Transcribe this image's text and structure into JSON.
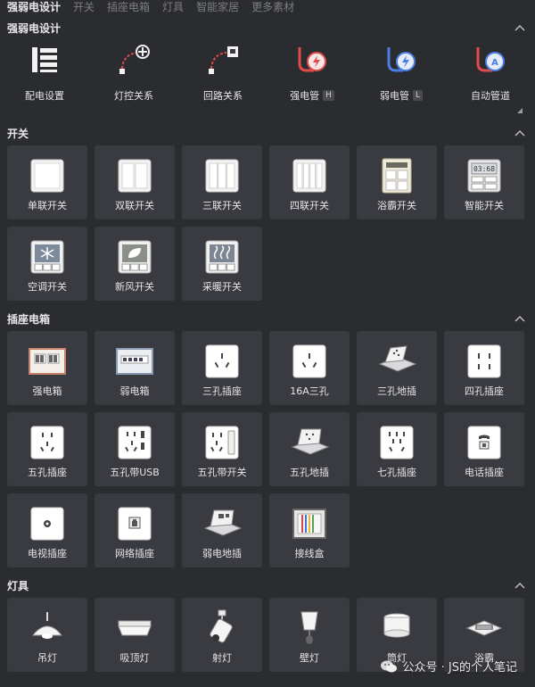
{
  "topnav": {
    "items": [
      {
        "label": "强弱电设计",
        "active": true
      },
      {
        "label": "开关",
        "active": false
      },
      {
        "label": "插座电箱",
        "active": false
      },
      {
        "label": "灯具",
        "active": false
      },
      {
        "label": "智能家居",
        "active": false
      },
      {
        "label": "更多素材",
        "active": false
      }
    ]
  },
  "sections": {
    "wiring": {
      "title": "强弱电设计",
      "collapse_icon": "chevron-up-icon",
      "tools": [
        {
          "label": "配电设置",
          "icon": "distribution-icon"
        },
        {
          "label": "灯控关系",
          "icon": "light-control-icon"
        },
        {
          "label": "回路关系",
          "icon": "circuit-icon"
        },
        {
          "label": "强电管",
          "tag": "H",
          "icon": "strong-pipe-icon",
          "color": "#e24b4b"
        },
        {
          "label": "弱电管",
          "tag": "L",
          "icon": "weak-pipe-icon",
          "color": "#4b7ee2"
        },
        {
          "label": "自动管道",
          "icon": "auto-pipe-icon",
          "color": "#4b7ee2"
        }
      ]
    },
    "switches": {
      "title": "开关",
      "items": [
        {
          "label": "单联开关",
          "icon": "single-switch-icon"
        },
        {
          "label": "双联开关",
          "icon": "double-switch-icon"
        },
        {
          "label": "三联开关",
          "icon": "triple-switch-icon"
        },
        {
          "label": "四联开关",
          "icon": "quad-switch-icon"
        },
        {
          "label": "浴霸开关",
          "icon": "bath-heater-switch-icon"
        },
        {
          "label": "智能开关",
          "icon": "smart-switch-icon",
          "display": "03:68"
        },
        {
          "label": "空调开关",
          "icon": "ac-switch-icon"
        },
        {
          "label": "新风开关",
          "icon": "fresh-air-switch-icon"
        },
        {
          "label": "采暖开关",
          "icon": "heating-switch-icon"
        }
      ]
    },
    "sockets": {
      "title": "插座电箱",
      "items": [
        {
          "label": "强电箱",
          "icon": "strong-box-icon"
        },
        {
          "label": "弱电箱",
          "icon": "weak-box-icon"
        },
        {
          "label": "三孔插座",
          "icon": "three-hole-socket-icon"
        },
        {
          "label": "16A三孔",
          "icon": "16a-socket-icon"
        },
        {
          "label": "三孔地插",
          "icon": "floor-socket-3-icon"
        },
        {
          "label": "四孔插座",
          "icon": "four-hole-socket-icon"
        },
        {
          "label": "五孔插座",
          "icon": "five-hole-socket-icon"
        },
        {
          "label": "五孔带USB",
          "icon": "usb-socket-icon"
        },
        {
          "label": "五孔带开关",
          "icon": "switched-socket-icon"
        },
        {
          "label": "五孔地插",
          "icon": "floor-socket-5-icon"
        },
        {
          "label": "七孔插座",
          "icon": "seven-hole-socket-icon"
        },
        {
          "label": "电话插座",
          "icon": "phone-socket-icon"
        },
        {
          "label": "电视插座",
          "icon": "tv-socket-icon"
        },
        {
          "label": "网络插座",
          "icon": "network-socket-icon"
        },
        {
          "label": "弱电地插",
          "icon": "weak-floor-socket-icon"
        },
        {
          "label": "接线盒",
          "icon": "junction-box-icon"
        }
      ]
    },
    "lights": {
      "title": "灯具",
      "items": [
        {
          "label": "吊灯",
          "icon": "pendant-lamp-icon"
        },
        {
          "label": "吸顶灯",
          "icon": "ceiling-lamp-icon"
        },
        {
          "label": "射灯",
          "icon": "spotlight-icon"
        },
        {
          "label": "壁灯",
          "icon": "wall-lamp-icon"
        },
        {
          "label": "筒灯",
          "icon": "downlight-icon"
        },
        {
          "label": "浴霸",
          "icon": "bath-heater-icon"
        }
      ]
    }
  },
  "watermark": {
    "text": "公众号 · JS的个人笔记",
    "icon": "wechat-icon"
  }
}
